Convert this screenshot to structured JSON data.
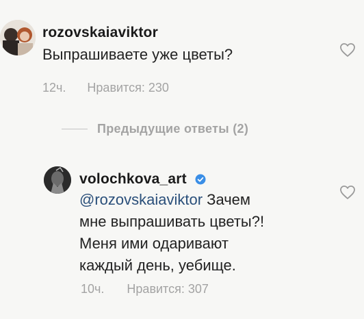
{
  "comment": {
    "username": "rozovskaiaviktor",
    "text": "Выпрашиваете уже цветы?",
    "time": "12ч.",
    "likes": "Нравится: 230"
  },
  "replies_toggle": {
    "label": "Предыдущие ответы (2)"
  },
  "reply": {
    "username": "volochkova_art",
    "mention": "@rozovskaiaviktor",
    "text_line1_rest": " Зачем",
    "text_line2": "мне выпрашивать цветы?!",
    "text_line3": "Меня ими одаривают",
    "text_line4": "каждый день, уебище.",
    "time": "10ч.",
    "likes": "Нравится: 307"
  },
  "icons": {
    "like": "heart-outline-icon",
    "verified": "verified-badge-icon"
  },
  "colors": {
    "background": "#f7f7f5",
    "meta_text": "#a3a3a3",
    "mention": "#2a4f7a",
    "verified": "#3a8ee6"
  }
}
